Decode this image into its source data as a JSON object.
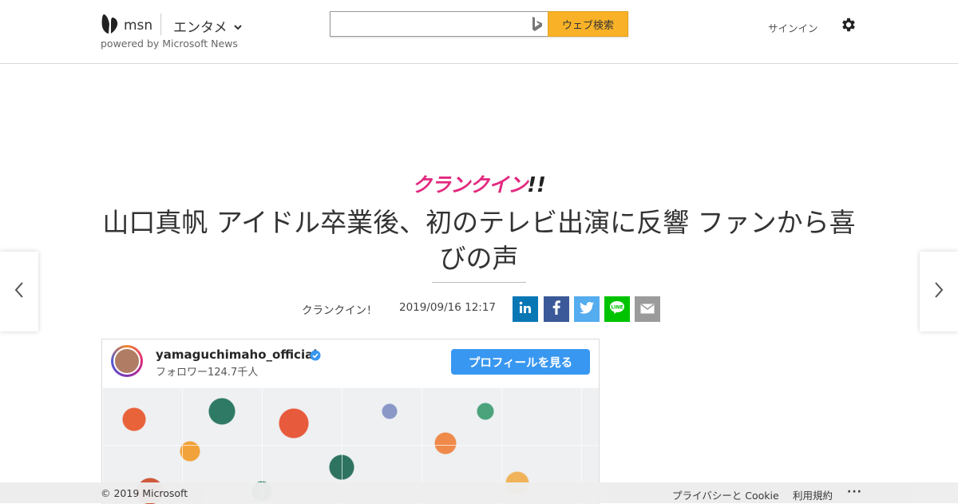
{
  "header": {
    "logo_text": "msn",
    "section_label": "エンタメ",
    "powered_by": "powered by Microsoft News",
    "search": {
      "value": "",
      "placeholder": "",
      "button_label": "ウェブ検索"
    },
    "signin_label": "サインイン"
  },
  "article": {
    "brand_logo": "クランクイン",
    "brand_bang": "!!",
    "title": "山口真帆 アイドル卒業後、初のテレビ出演に反響 ファンから喜びの声",
    "source": "クランクイン！",
    "date": "2019/09/16 12:17",
    "share": [
      {
        "name": "linkedin",
        "color": "#0a77b5",
        "glyph": "in"
      },
      {
        "name": "facebook",
        "color": "#3b5998",
        "glyph": "f"
      },
      {
        "name": "twitter",
        "color": "#55acee",
        "glyph": ""
      },
      {
        "name": "line",
        "color": "#00c300",
        "glyph": ""
      },
      {
        "name": "email",
        "color": "#9b9b9b",
        "glyph": ""
      }
    ]
  },
  "embed": {
    "username": "yamaguchimaho_official",
    "followers": "フォロワー124.7千人",
    "profile_button": "プロフィールを見る"
  },
  "footer": {
    "copyright": "© 2019 Microsoft",
    "privacy": "プライバシーと Cookie",
    "terms": "利用規約",
    "more": "···"
  },
  "colors": {
    "search_button": "#f9b227",
    "brand_pink": "#e2287f",
    "ig_blue": "#3897f0"
  },
  "icons": [
    "msn-butterfly-icon",
    "chevron-down-icon",
    "bing-icon",
    "gear-icon",
    "chevron-left-icon",
    "chevron-right-icon",
    "verified-badge-icon"
  ]
}
